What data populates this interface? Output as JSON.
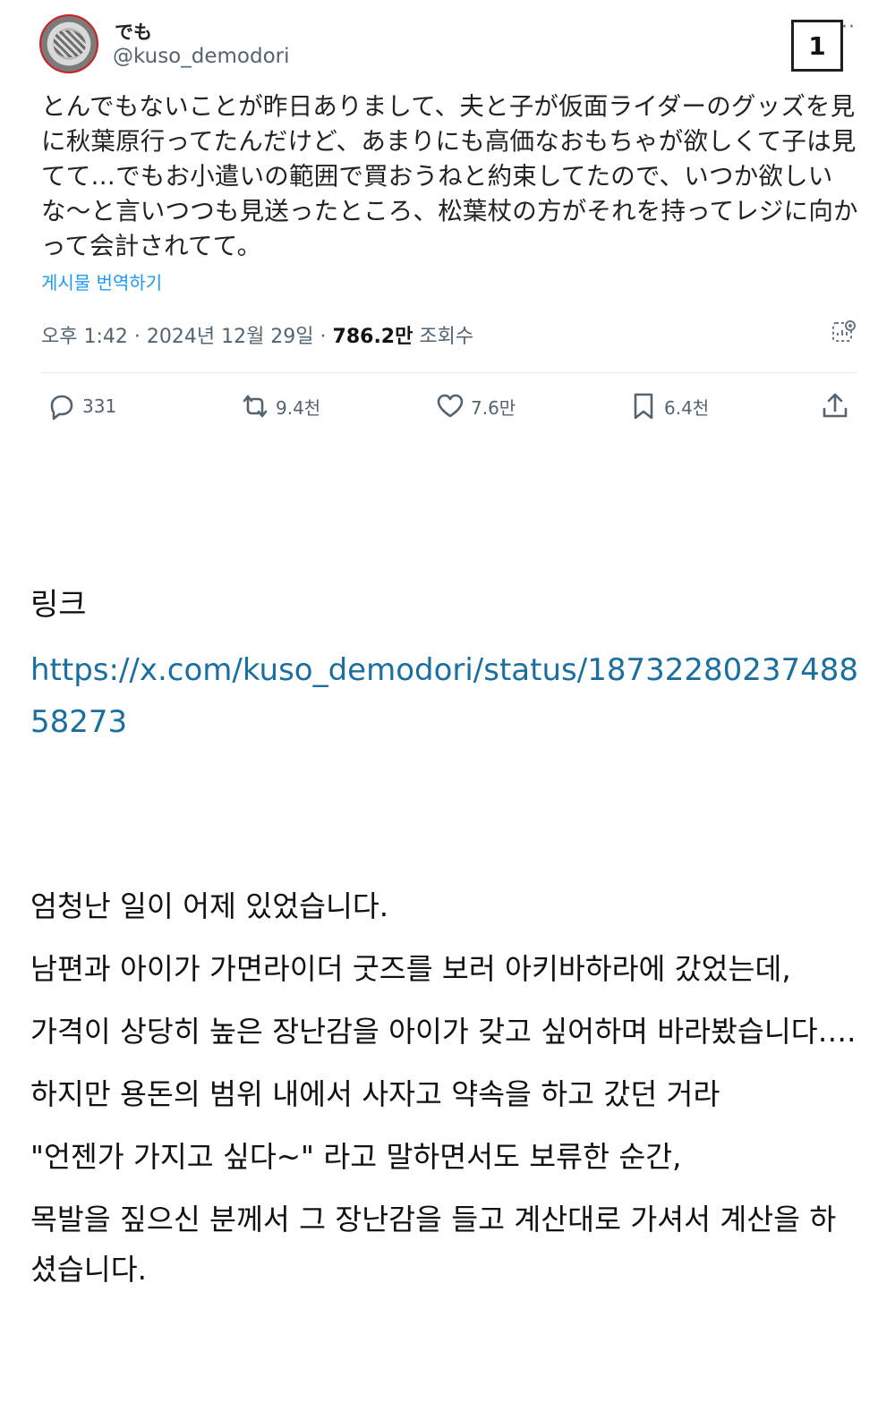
{
  "tweet": {
    "display_name": "でも",
    "handle": "@kuso_demodori",
    "page_number": "1",
    "more": "··",
    "text_lines": [
      "とんでもないことが昨日ありまして、夫と子が仮面ライダーのグッズを見",
      "に秋葉原行ってたんだけど、あまりにも高価なおもちゃが欲しくて子は見",
      "てて…でもお小遣いの範囲で買おうねと約束してたので、いつか欲しい",
      "な〜と言いつつも見送ったところ、松葉杖の方がそれを持ってレジに向か",
      "って会計されてて。"
    ],
    "translate_label": "게시물 번역하기",
    "timestamp": "오후 1:42 · 2024년 12월 29일 · ",
    "views_count": "786.2만",
    "views_label": " 조회수",
    "actions": {
      "replies": "331",
      "retweets": "9.4천",
      "likes": "7.6만",
      "bookmarks": "6.4천"
    }
  },
  "article": {
    "link_label": "링크",
    "link_url": "https://x.com/kuso_demodori/status/1873228023748858273",
    "paragraphs": [
      "엄청난 일이 어제 있었습니다.",
      "남편과 아이가 가면라이더 굿즈를 보러 아키바하라에 갔었는데,",
      "가격이 상당히 높은 장난감을 아이가 갖고 싶어하며 바라봤습니다….",
      "하지만 용돈의 범위 내에서 사자고 약속을 하고 갔던 거라",
      "\"언젠가 가지고 싶다~\" 라고 말하면서도 보류한 순간,",
      "목발을 짚으신 분께서 그 장난감을 들고 계산대로 가셔서 계산을 하셨습니다."
    ]
  },
  "colors": {
    "link_blue": "#1a6fa0",
    "x_blue": "#1d9bf0",
    "muted": "#536471",
    "text": "#111111"
  }
}
